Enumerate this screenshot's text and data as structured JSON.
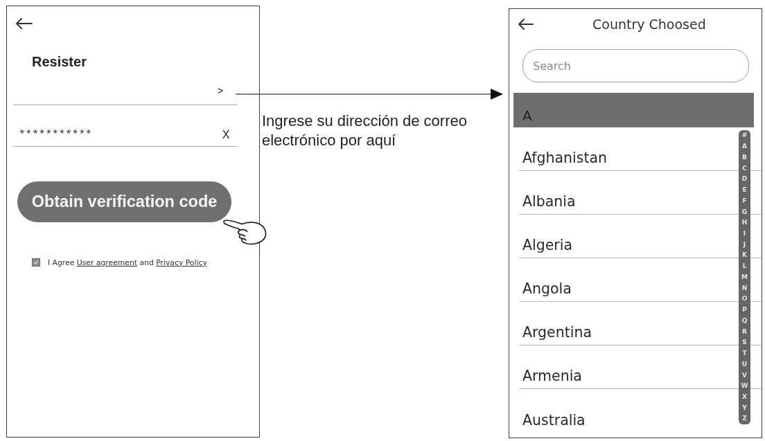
{
  "register_screen": {
    "title": "Resister",
    "fields": [
      {
        "trailing": {
          "kind": "next",
          "text": ">"
        }
      },
      {
        "value": "***********",
        "trailing": {
          "kind": "clear",
          "text": "X"
        }
      }
    ],
    "button": "Obtain verification code",
    "agreement": {
      "checked": true,
      "prefix": "I Agree",
      "link_1": "User agreement",
      "middle": "and",
      "link_2": "Privacy Policy"
    }
  },
  "annotation": {
    "text": "Ingrese su dirección de correo electrónico por aquí"
  },
  "country_screen": {
    "title": "Country Choosed",
    "search": {
      "placeholder": "Search"
    },
    "section": "A",
    "countries": [
      "Afghanistan",
      "Albania",
      "Algeria",
      "Angola",
      "Argentina",
      "Armenia",
      "Australia"
    ],
    "index": [
      "#",
      "A",
      "B",
      "C",
      "D",
      "E",
      "F",
      "G",
      "H",
      "I",
      "J",
      "K",
      "L",
      "M",
      "N",
      "O",
      "P",
      "Q",
      "R",
      "S",
      "T",
      "U",
      "V",
      "W",
      "X",
      "Y",
      "Z"
    ]
  }
}
